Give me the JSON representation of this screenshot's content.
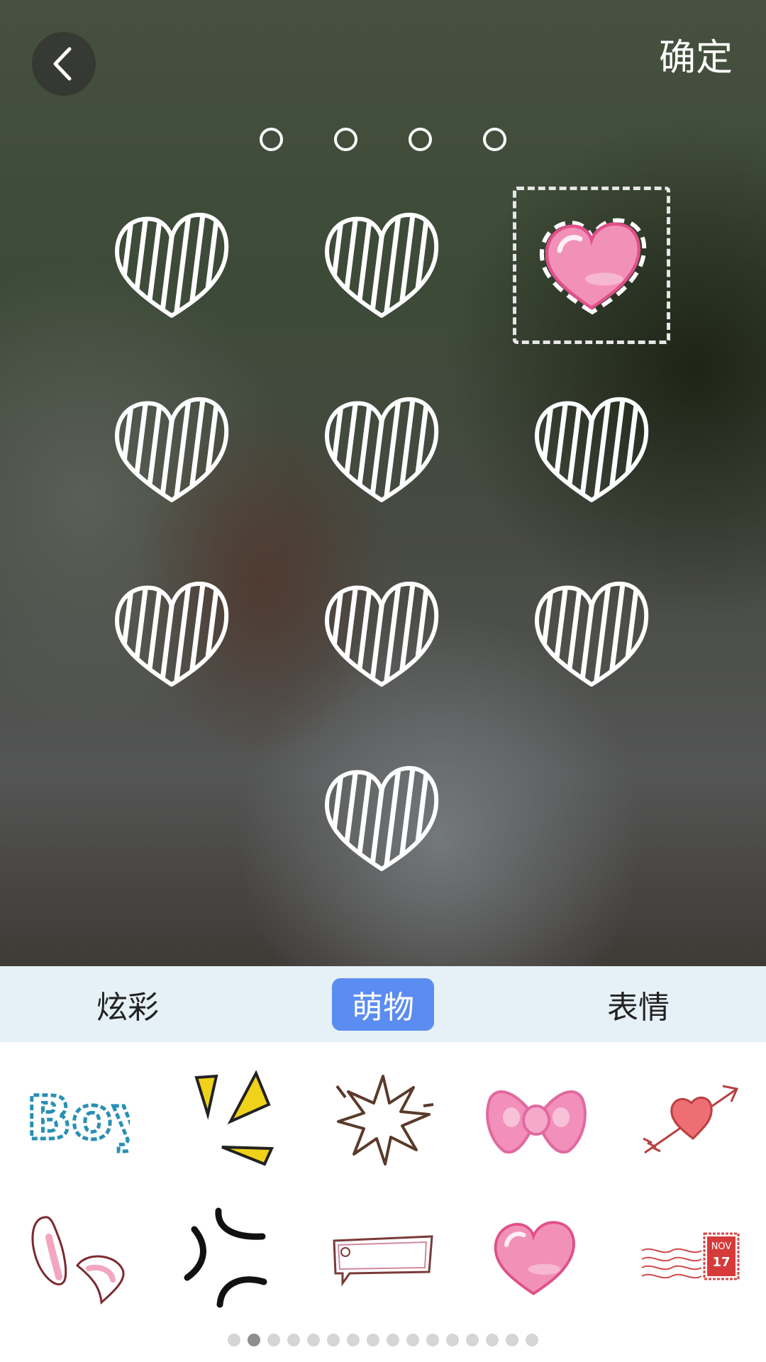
{
  "header": {
    "back_icon": "chevron-left-icon",
    "confirm_label": "确定"
  },
  "pattern": {
    "top_dots": 4,
    "heart_positions": [
      [
        1,
        1
      ],
      [
        1,
        2
      ],
      [
        2,
        1
      ],
      [
        2,
        2
      ],
      [
        2,
        3
      ],
      [
        3,
        1
      ],
      [
        3,
        2
      ],
      [
        3,
        3
      ],
      [
        4,
        2
      ]
    ],
    "selected_sticker_icon": "pink-heart-icon"
  },
  "tabs": {
    "items": [
      {
        "label": "炫彩"
      },
      {
        "label": "萌物"
      },
      {
        "label": "表情"
      }
    ],
    "active_index": 1,
    "active_color": "#5b8df0",
    "bar_color": "#e6f1f7"
  },
  "stickers": {
    "row1": [
      "boy-text-icon",
      "yellow-spark-icon",
      "burst-icon",
      "pink-bow-icon",
      "heart-arrow-icon"
    ],
    "row2": [
      "bunny-ears-icon",
      "anger-mark-icon",
      "banner-frame-icon",
      "pink-heart-icon",
      "stamp-icon"
    ],
    "stamp_text": {
      "month": "NOV",
      "day": "17"
    },
    "boy_text": "Boy"
  },
  "pager": {
    "count": 16,
    "active_index": 1
  }
}
